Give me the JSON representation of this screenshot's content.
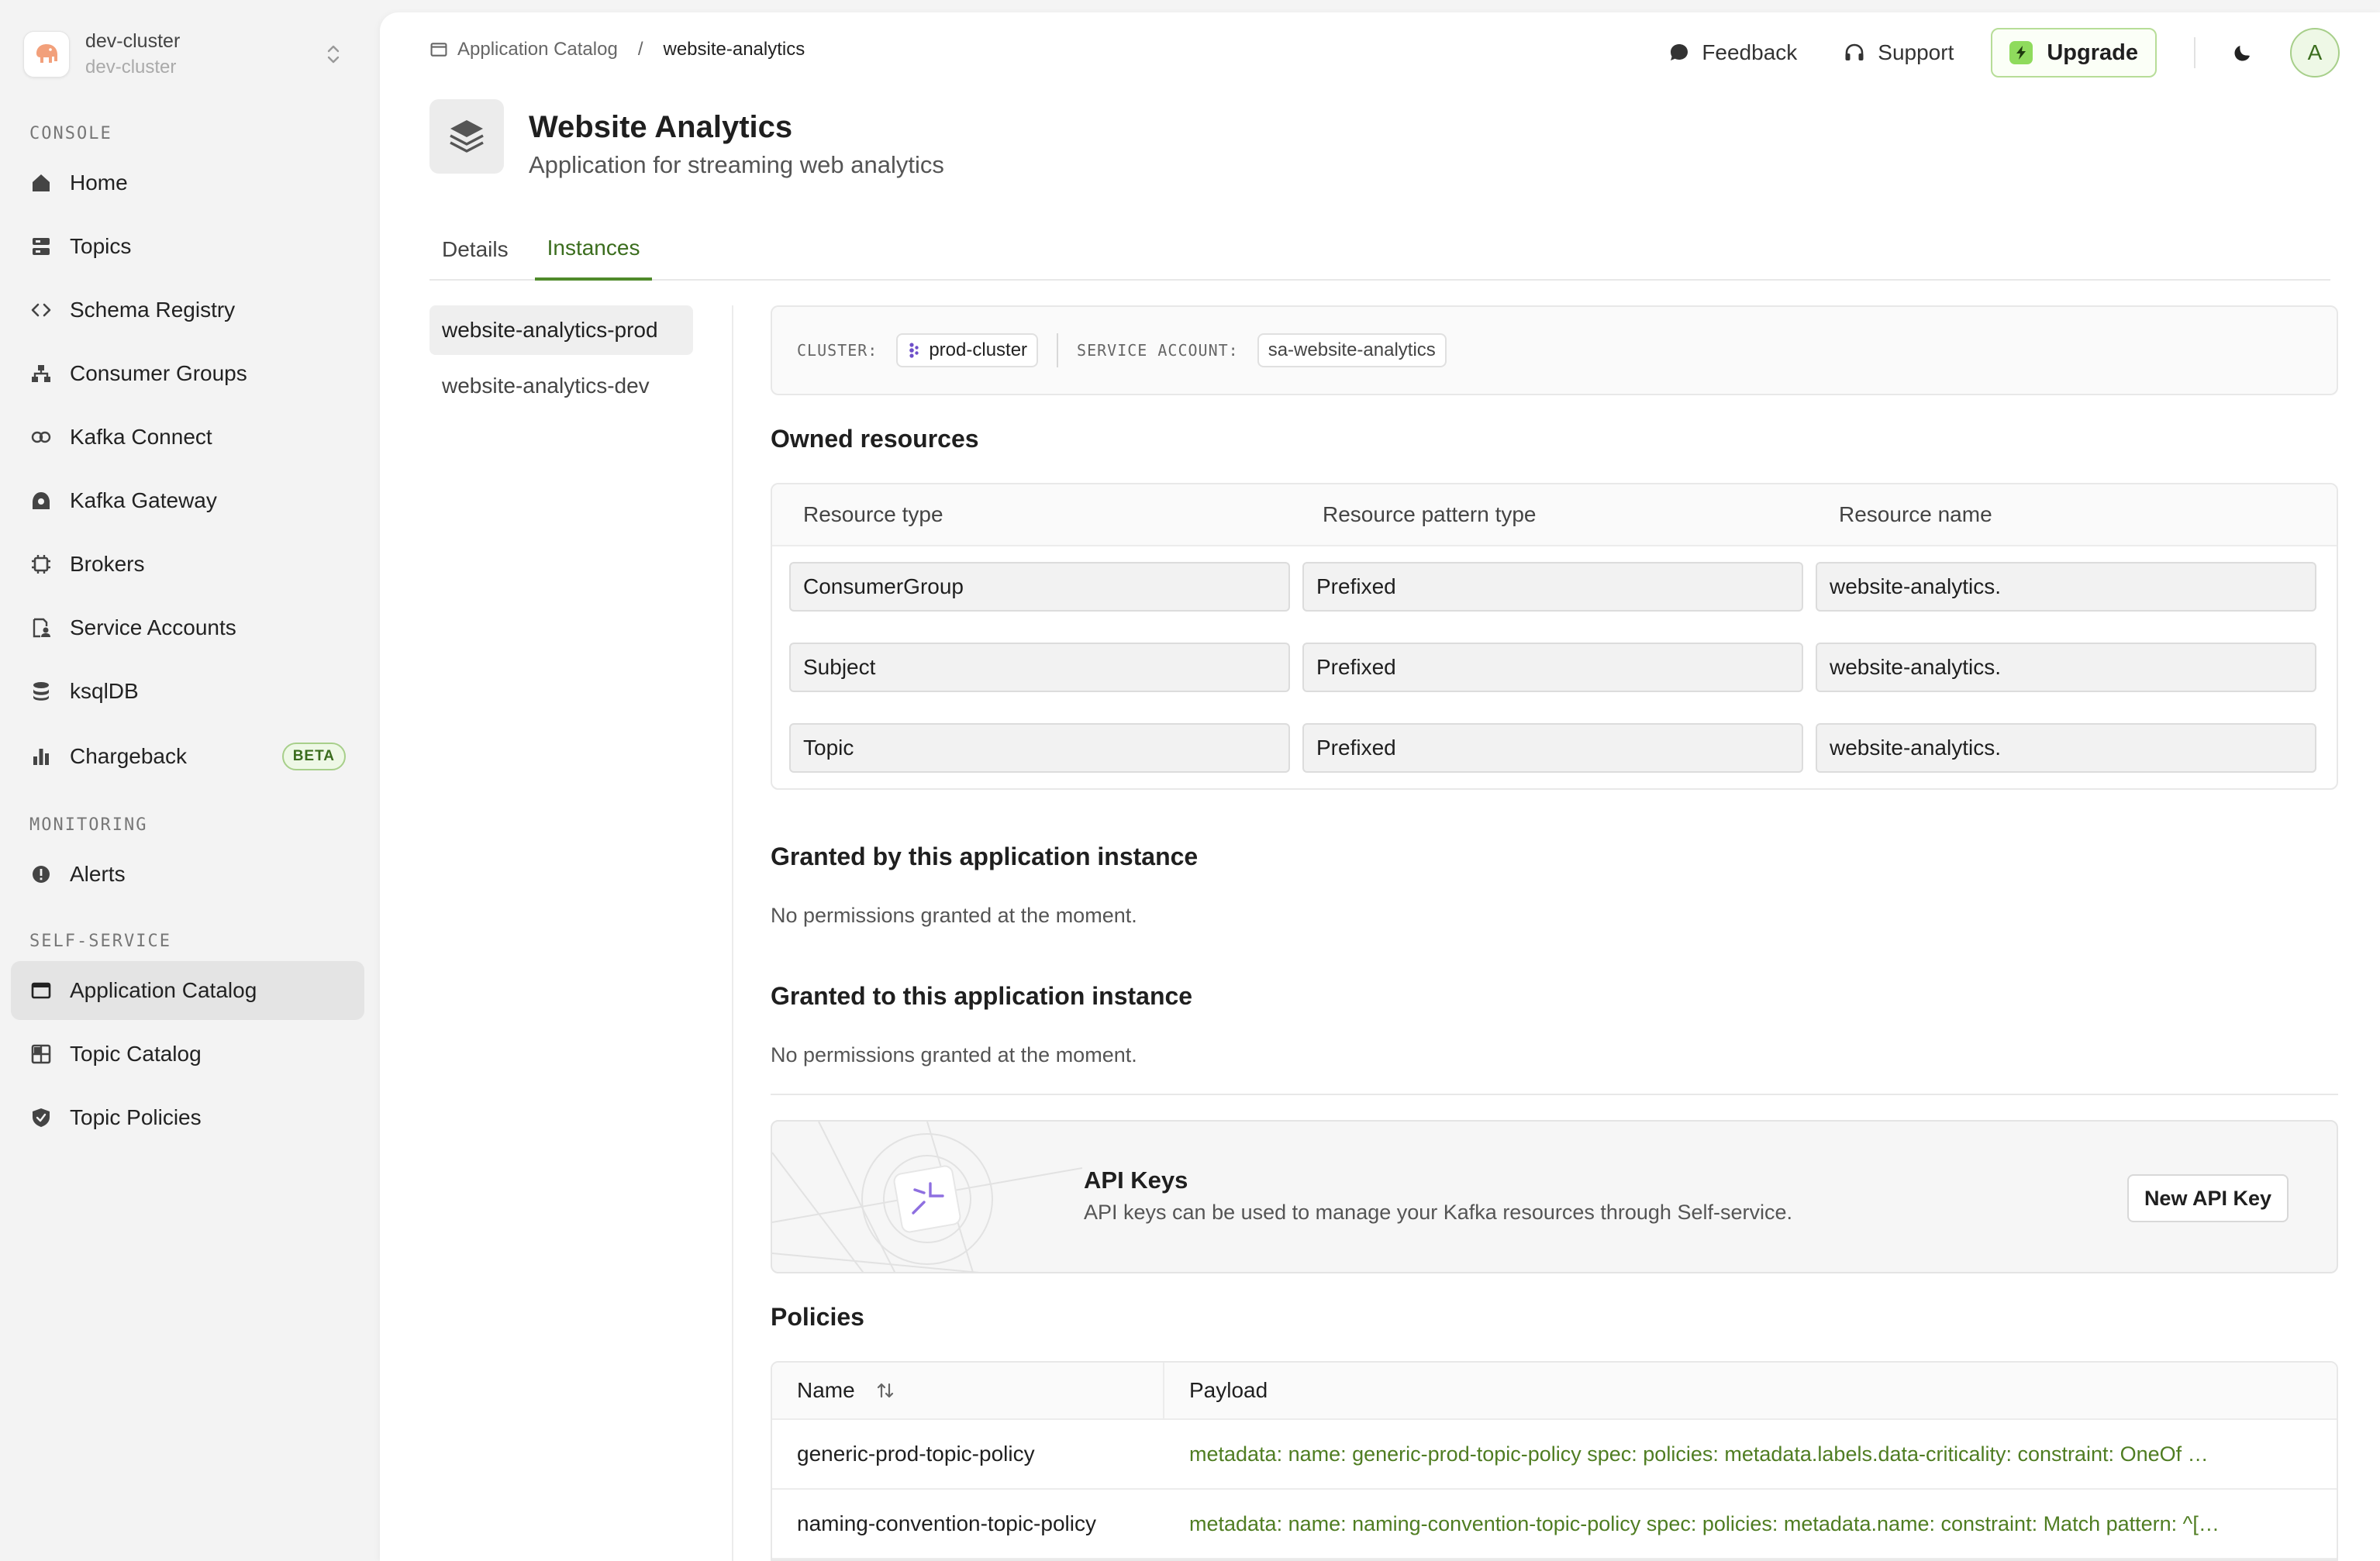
{
  "cluster": {
    "name": "dev-cluster",
    "subname": "dev-cluster"
  },
  "sidebar": {
    "sections": [
      {
        "label": "CONSOLE"
      },
      {
        "label": "MONITORING"
      },
      {
        "label": "SELF-SERVICE"
      }
    ],
    "items": [
      {
        "label": "Home",
        "icon": "home-icon"
      },
      {
        "label": "Topics",
        "icon": "topics-icon"
      },
      {
        "label": "Schema Registry",
        "icon": "code-icon"
      },
      {
        "label": "Consumer Groups",
        "icon": "consumer-groups-icon"
      },
      {
        "label": "Kafka Connect",
        "icon": "connect-icon"
      },
      {
        "label": "Kafka Gateway",
        "icon": "gateway-icon"
      },
      {
        "label": "Brokers",
        "icon": "chip-icon"
      },
      {
        "label": "Service Accounts",
        "icon": "service-account-icon"
      },
      {
        "label": "ksqlDB",
        "icon": "database-icon"
      },
      {
        "label": "Chargeback",
        "icon": "bar-chart-icon",
        "badge": "BETA"
      },
      {
        "label": "Alerts",
        "icon": "alert-icon"
      },
      {
        "label": "Application Catalog",
        "icon": "app-window-icon",
        "active": true
      },
      {
        "label": "Topic Catalog",
        "icon": "grid-icon"
      },
      {
        "label": "Topic Policies",
        "icon": "shield-icon"
      }
    ]
  },
  "breadcrumb": {
    "parent": "Application Catalog",
    "separator": "/",
    "current": "website-analytics"
  },
  "topbar": {
    "feedback": "Feedback",
    "support": "Support",
    "upgrade": "Upgrade",
    "avatar_initial": "A"
  },
  "header": {
    "title": "Website Analytics",
    "subtitle": "Application for streaming web analytics"
  },
  "tabs": [
    {
      "label": "Details",
      "active": false
    },
    {
      "label": "Instances",
      "active": true
    }
  ],
  "instances": [
    {
      "label": "website-analytics-prod",
      "active": true
    },
    {
      "label": "website-analytics-dev",
      "active": false
    }
  ],
  "instance": {
    "cluster_label": "CLUSTER:",
    "cluster_value": "prod-cluster",
    "service_account_label": "SERVICE ACCOUNT:",
    "service_account_value": "sa-website-analytics"
  },
  "owned": {
    "title": "Owned resources",
    "columns": [
      "Resource type",
      "Resource pattern type",
      "Resource name"
    ],
    "rows": [
      [
        "ConsumerGroup",
        "Prefixed",
        "website-analytics."
      ],
      [
        "Subject",
        "Prefixed",
        "website-analytics."
      ],
      [
        "Topic",
        "Prefixed",
        "website-analytics."
      ]
    ]
  },
  "granted_by": {
    "title": "Granted by this application instance",
    "empty": "No permissions granted at the moment."
  },
  "granted_to": {
    "title": "Granted to this application instance",
    "empty": "No permissions granted at the moment."
  },
  "api_keys": {
    "title": "API Keys",
    "description": "API keys can be used to manage your Kafka resources through Self-service.",
    "button": "New API Key"
  },
  "policies": {
    "title": "Policies",
    "columns": [
      "Name",
      "Payload"
    ],
    "rows": [
      {
        "name": "generic-prod-topic-policy",
        "payload": "metadata: name: generic-prod-topic-policy spec: policies: metadata.labels.data-criticality: constraint: OneOf …"
      },
      {
        "name": "naming-convention-topic-policy",
        "payload": "metadata: name: naming-convention-topic-policy spec: policies: metadata.name: constraint: Match pattern: ^[…"
      }
    ]
  },
  "colors": {
    "accent": "#4f8a2b",
    "accent_light": "#eef8e6",
    "payload": "#4f7d22"
  }
}
